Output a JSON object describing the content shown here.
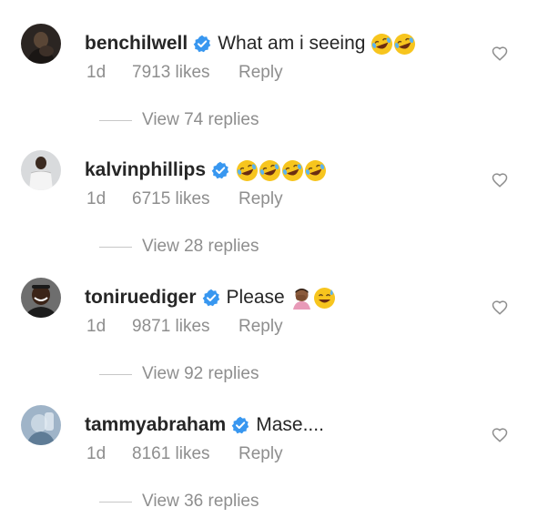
{
  "comments": [
    {
      "username": "benchilwell",
      "text": "What am i seeing",
      "emojis": [
        "rofl-emoji",
        "rofl-emoji"
      ],
      "time": "1d",
      "likes": "7913 likes",
      "reply": "Reply",
      "view_replies": "View 74 replies",
      "avatar_style": "dark"
    },
    {
      "username": "kalvinphillips",
      "text": "",
      "emojis": [
        "rofl-emoji",
        "rofl-emoji",
        "rofl-emoji",
        "rofl-emoji"
      ],
      "time": "1d",
      "likes": "6715 likes",
      "reply": "Reply",
      "view_replies": "View 28 replies",
      "avatar_style": "light"
    },
    {
      "username": "toniruediger",
      "text": "Please",
      "emojis": [
        "person-facepalming-emoji",
        "sweat-smile-emoji"
      ],
      "time": "1d",
      "likes": "9871 likes",
      "reply": "Reply",
      "view_replies": "View 92 replies",
      "avatar_style": "portrait"
    },
    {
      "username": "tammyabraham",
      "text": "Mase....",
      "emojis": [],
      "time": "1d",
      "likes": "8161 likes",
      "reply": "Reply",
      "view_replies": "View 36 replies",
      "avatar_style": "blue"
    }
  ],
  "colors": {
    "verified_blue": "#3897f0",
    "meta_gray": "#8e8e8e",
    "text_dark": "#262626"
  }
}
